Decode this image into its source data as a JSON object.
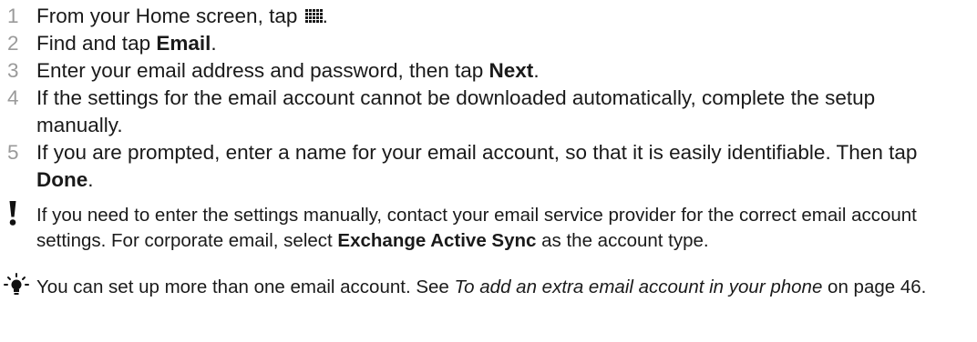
{
  "steps": [
    {
      "num": "1",
      "pre": "From your Home screen, tap ",
      "icon": "app-grid-icon",
      "post": "."
    },
    {
      "num": "2",
      "pre": "Find and tap ",
      "bold": "Email",
      "post": "."
    },
    {
      "num": "3",
      "pre": "Enter your email address and password, then tap ",
      "bold": "Next",
      "post": "."
    },
    {
      "num": "4",
      "text": "If the settings for the email account cannot be downloaded automatically, complete the setup manually."
    },
    {
      "num": "5",
      "pre": "If you are prompted, enter a name for your email account, so that it is easily identifiable. Then tap ",
      "bold": "Done",
      "post": "."
    }
  ],
  "warning_note": {
    "icon": "exclamation-icon",
    "pre": "If you need to enter the settings manually, contact your email service provider for the correct email account settings. For corporate email, select ",
    "bold": "Exchange Active Sync",
    "post": " as the account type."
  },
  "tip_note": {
    "icon": "lightbulb-icon",
    "pre": "You can set up more than one email account. See ",
    "italic": "To add an extra email account in your phone",
    "post": " on page 46."
  },
  "colors": {
    "step_number": "#9a9a9a",
    "text": "#1a1a1a"
  }
}
